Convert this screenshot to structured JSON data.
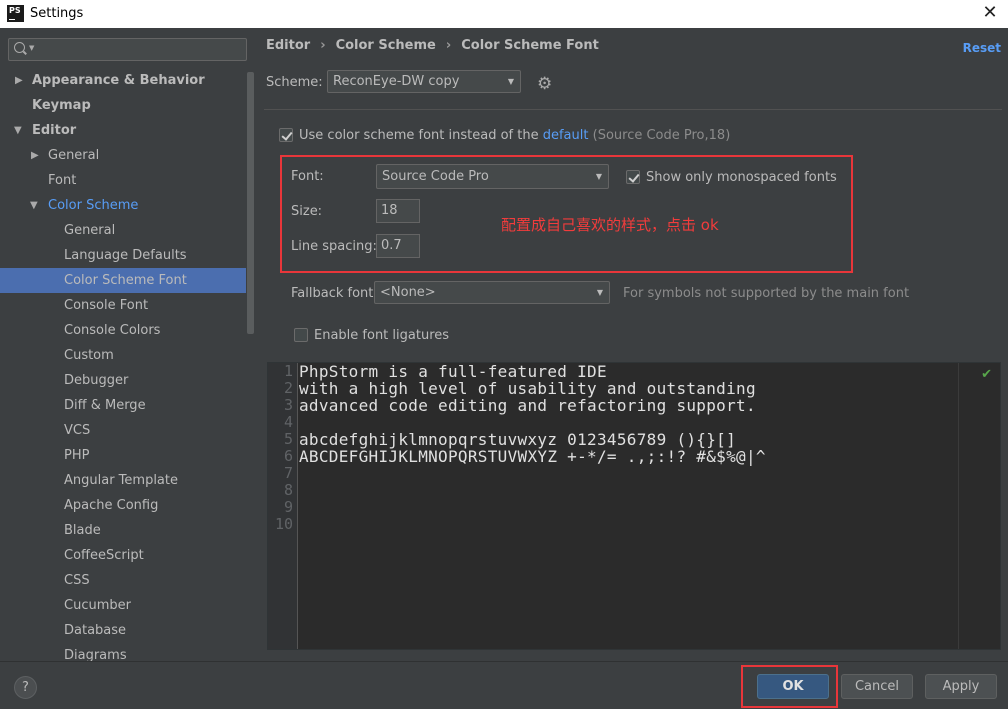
{
  "window": {
    "app_icon_text": "PS",
    "title": "Settings",
    "close_glyph": "✕"
  },
  "sidebar": {
    "search_placeholder": "",
    "items": [
      {
        "label": "Appearance & Behavior",
        "expander": "▶"
      },
      {
        "label": "Keymap"
      },
      {
        "label": "Editor",
        "expander": "▼"
      },
      {
        "label": "General",
        "expander": "▶"
      },
      {
        "label": "Font"
      },
      {
        "label": "Color Scheme",
        "expander": "▼"
      },
      {
        "label": "General"
      },
      {
        "label": "Language Defaults"
      },
      {
        "label": "Color Scheme Font"
      },
      {
        "label": "Console Font"
      },
      {
        "label": "Console Colors"
      },
      {
        "label": "Custom"
      },
      {
        "label": "Debugger"
      },
      {
        "label": "Diff & Merge"
      },
      {
        "label": "VCS"
      },
      {
        "label": "PHP"
      },
      {
        "label": "Angular Template"
      },
      {
        "label": "Apache Config"
      },
      {
        "label": "Blade"
      },
      {
        "label": "CoffeeScript"
      },
      {
        "label": "CSS"
      },
      {
        "label": "Cucumber"
      },
      {
        "label": "Database"
      },
      {
        "label": "Diagrams"
      }
    ]
  },
  "breadcrumb": [
    "Editor",
    "Color Scheme",
    "Color Scheme Font"
  ],
  "breadcrumb_separator": "›",
  "reset_label": "Reset",
  "scheme": {
    "label": "Scheme:",
    "value": "ReconEye-DW copy",
    "gear_glyph": "⚙"
  },
  "use_scheme_font": {
    "checked": true,
    "label": "Use color scheme font instead of the",
    "link": "default",
    "hint": "(Source Code Pro,18)"
  },
  "font": {
    "label": "Font:",
    "value": "Source Code Pro",
    "mono_checked": true,
    "mono_label": "Show only monospaced fonts"
  },
  "size": {
    "label": "Size:",
    "value": "18"
  },
  "line_spacing": {
    "label": "Line spacing:",
    "value": "0.7"
  },
  "annotation": "配置成自己喜欢的样式，点击 ok",
  "fallback": {
    "label": "Fallback font:",
    "value": "<None>",
    "hint": "For symbols not supported by the main font"
  },
  "ligatures": {
    "checked": false,
    "label": "Enable font ligatures"
  },
  "preview": {
    "line_numbers": [
      "1",
      "2",
      "3",
      "4",
      "5",
      "6",
      "7",
      "8",
      "9",
      "10"
    ],
    "lines": [
      "PhpStorm is a full-featured IDE",
      "with a high level of usability and outstanding",
      "advanced code editing and refactoring support.",
      "",
      "abcdefghijklmnopqrstuvwxyz 0123456789 (){}[]",
      "ABCDEFGHIJKLMNOPQRSTUVWXYZ +-*/= .,;:!? #&$%@|^"
    ],
    "status_glyph": "✔"
  },
  "footer": {
    "help": "?",
    "ok": "OK",
    "cancel": "Cancel",
    "apply": "Apply"
  },
  "colors": {
    "accent_link": "#589df6",
    "selection": "#4b6eaf",
    "annotation_red": "#e8363a",
    "primary_button": "#365880"
  }
}
